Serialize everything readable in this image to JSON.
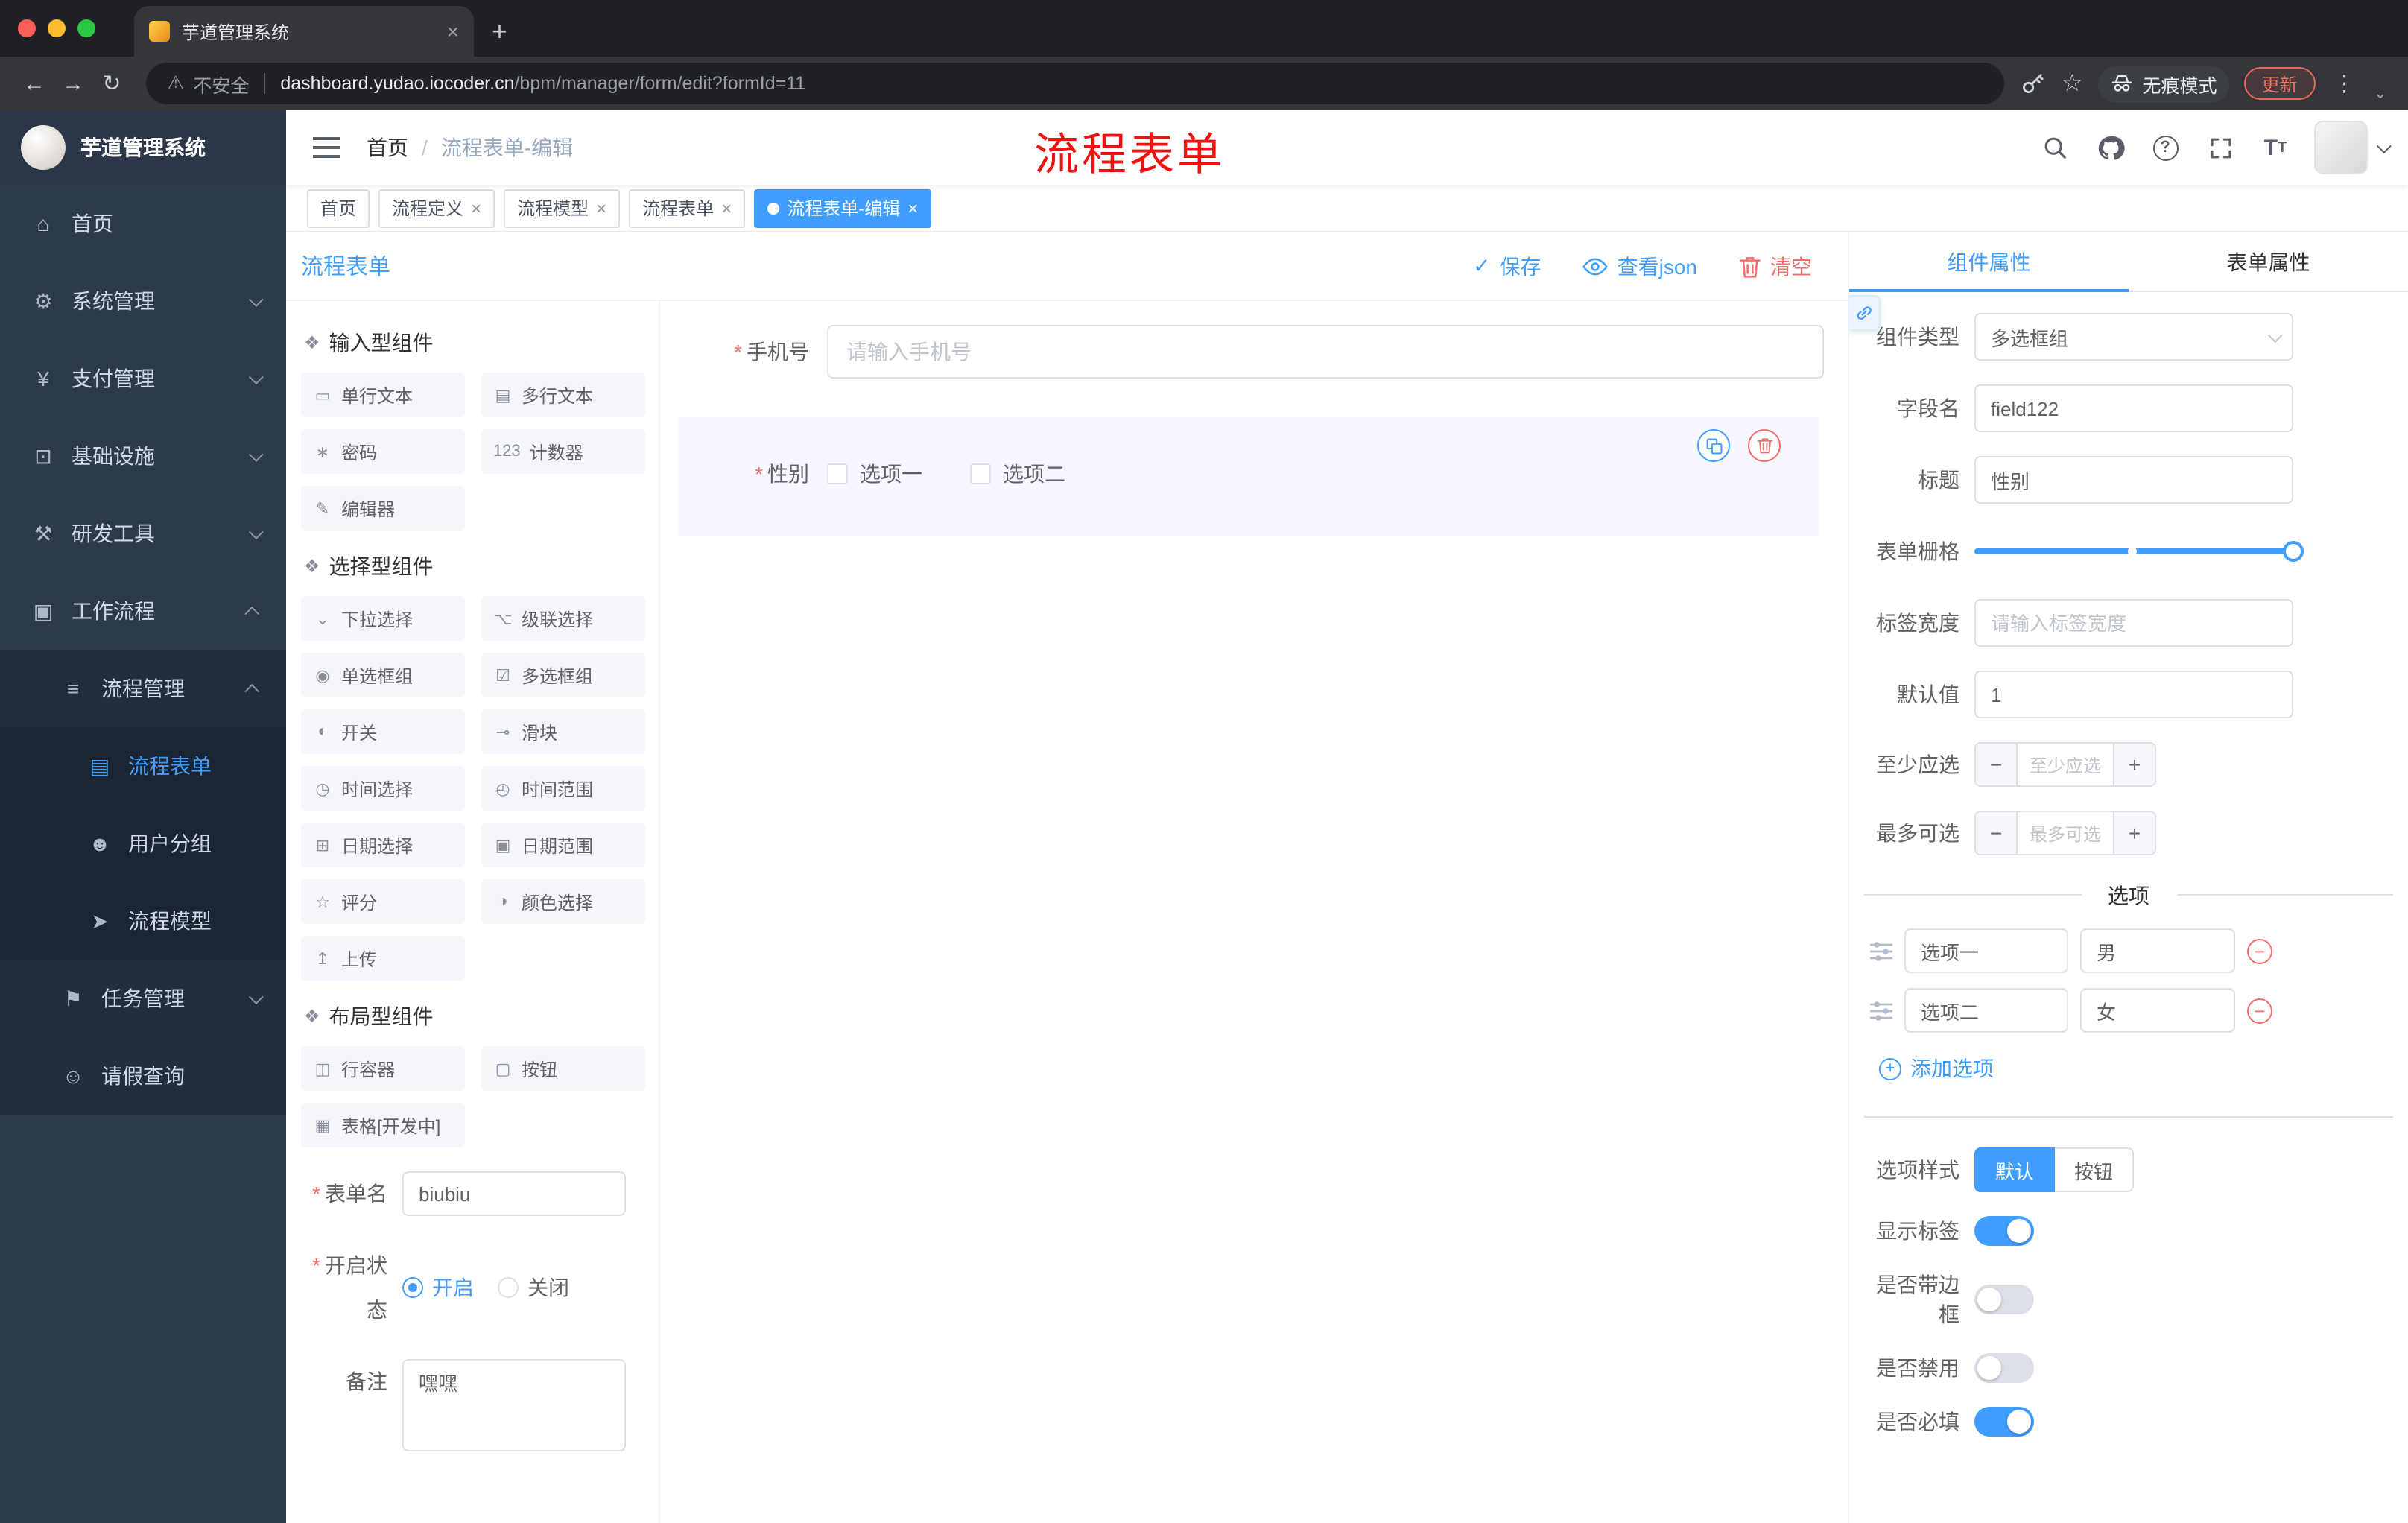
{
  "browser": {
    "tab_title": "芋道管理系统",
    "new_tab": "+",
    "security_label": "不安全",
    "url_domain": "dashboard.yudao.iocoder.cn",
    "url_path": "/bpm/manager/form/edit?formId=11",
    "incognito_label": "无痕模式",
    "update_label": "更新",
    "colors": {
      "chrome_dark": "#202124",
      "toolbar": "#35363a"
    }
  },
  "sidebar": {
    "logo_title": "芋道管理系统",
    "items": [
      {
        "label": "首页",
        "glyph": "⌂"
      },
      {
        "label": "系统管理",
        "glyph": "⚙"
      },
      {
        "label": "支付管理",
        "glyph": "¥"
      },
      {
        "label": "基础设施",
        "glyph": "⊡"
      },
      {
        "label": "研发工具",
        "glyph": "⚒"
      },
      {
        "label": "工作流程",
        "glyph": "▣"
      },
      {
        "label": "流程管理",
        "glyph": "≡"
      },
      {
        "label": "流程表单",
        "glyph": "▤"
      },
      {
        "label": "用户分组",
        "glyph": "☻"
      },
      {
        "label": "流程模型",
        "glyph": "➤"
      },
      {
        "label": "任务管理",
        "glyph": "⚑"
      },
      {
        "label": "请假查询",
        "glyph": "☺"
      }
    ]
  },
  "header": {
    "breadcrumb_home": "首页",
    "breadcrumb_sep": "/",
    "breadcrumb_current": "流程表单-编辑",
    "annotation": "流程表单"
  },
  "tags": {
    "t0": "首页",
    "t1": "流程定义",
    "t2": "流程模型",
    "t3": "流程表单",
    "t4": "流程表单-编辑"
  },
  "designer": {
    "title": "流程表单",
    "save": "保存",
    "view_json": "查看json",
    "clear": "清空",
    "groups": [
      {
        "title": "输入型组件",
        "items": [
          {
            "label": "单行文本",
            "glyph": "▭"
          },
          {
            "label": "多行文本",
            "glyph": "▤"
          },
          {
            "label": "密码",
            "glyph": "∗"
          },
          {
            "label": "计数器",
            "glyph": "123"
          },
          {
            "label": "编辑器",
            "glyph": "✎"
          }
        ]
      },
      {
        "title": "选择型组件",
        "items": [
          {
            "label": "下拉选择",
            "glyph": "⌄"
          },
          {
            "label": "级联选择",
            "glyph": "⌥"
          },
          {
            "label": "单选框组",
            "glyph": "◉"
          },
          {
            "label": "多选框组",
            "glyph": "☑"
          },
          {
            "label": "开关",
            "glyph": "◐"
          },
          {
            "label": "滑块",
            "glyph": "⊸"
          },
          {
            "label": "时间选择",
            "glyph": "◷"
          },
          {
            "label": "时间范围",
            "glyph": "◴"
          },
          {
            "label": "日期选择",
            "glyph": "⊞"
          },
          {
            "label": "日期范围",
            "glyph": "▣"
          },
          {
            "label": "评分",
            "glyph": "☆"
          },
          {
            "label": "颜色选择",
            "glyph": "◑"
          },
          {
            "label": "上传",
            "glyph": "↥"
          }
        ]
      },
      {
        "title": "布局型组件",
        "items": [
          {
            "label": "行容器",
            "glyph": "◫"
          },
          {
            "label": "按钮",
            "glyph": "▢"
          },
          {
            "label": "表格[开发中]",
            "glyph": "▦"
          }
        ]
      }
    ],
    "meta": {
      "form_name_label": "表单名",
      "form_name_value": "biubiu",
      "status_label": "开启状态",
      "status_on": "开启",
      "status_off": "关闭",
      "remark_label": "备注",
      "remark_value": "嘿嘿"
    },
    "canvas": {
      "phone_label": "手机号",
      "phone_placeholder": "请输入手机号",
      "gender_label": "性别",
      "gender_opt1": "选项一",
      "gender_opt2": "选项二"
    }
  },
  "props": {
    "tab_component": "组件属性",
    "tab_form": "表单属性",
    "component_type_label": "组件类型",
    "component_type_value": "多选框组",
    "field_name_label": "字段名",
    "field_name_value": "field122",
    "title_label": "标题",
    "title_value": "性别",
    "grid_label": "表单栅格",
    "label_width_label": "标签宽度",
    "label_width_placeholder": "请输入标签宽度",
    "default_label": "默认值",
    "default_value": "1",
    "min_label": "至少应选",
    "min_placeholder": "至少应选",
    "max_label": "最多可选",
    "max_placeholder": "最多可选",
    "options_title": "选项",
    "options": [
      {
        "name": "选项一",
        "value": "男"
      },
      {
        "name": "选项二",
        "value": "女"
      }
    ],
    "add_option": "添加选项",
    "style_label": "选项样式",
    "style_default": "默认",
    "style_button": "按钮",
    "show_label": "显示标签",
    "border_label": "是否带边框",
    "disabled_label": "是否禁用",
    "required_label": "是否必填",
    "accent_color": "#409eff",
    "danger_color": "#f56c6c"
  }
}
